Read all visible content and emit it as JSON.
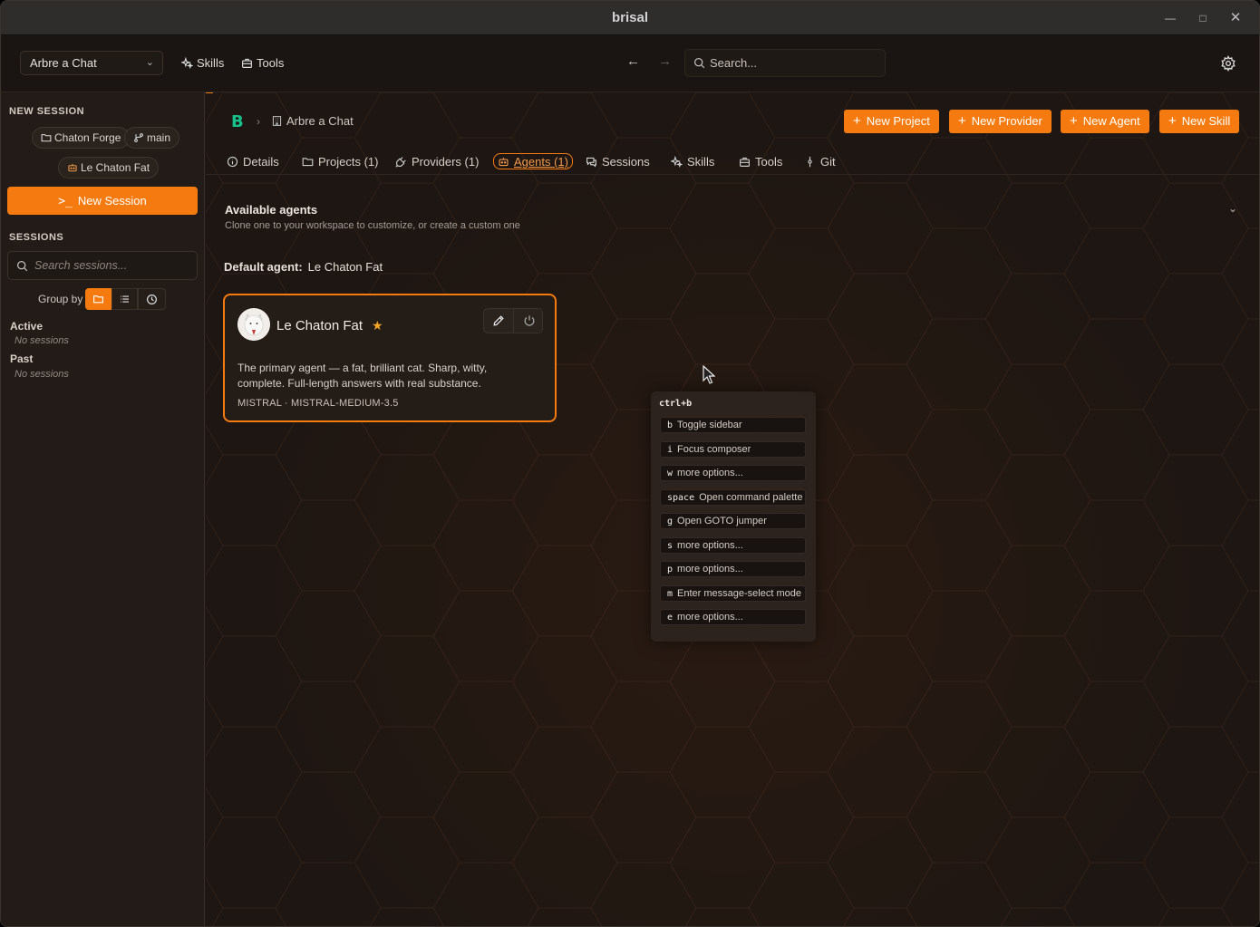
{
  "window": {
    "title": "brisal"
  },
  "header": {
    "project_select": "Arbre a Chat",
    "skills_label": "Skills",
    "tools_label": "Tools",
    "search_placeholder": "Search..."
  },
  "sidebar": {
    "new_session_title": "NEW SESSION",
    "chips": {
      "project": "Chaton Forge",
      "branch": "main",
      "agent": "Le Chaton Fat"
    },
    "new_session_button": "New Session",
    "sessions_title": "SESSIONS",
    "search_placeholder": "Search sessions...",
    "group_by_label": "Group by",
    "groups": [
      {
        "title": "Active",
        "empty": "No sessions"
      },
      {
        "title": "Past",
        "empty": "No sessions"
      }
    ]
  },
  "main": {
    "brand": "B",
    "breadcrumb": "Arbre a Chat",
    "buttons": {
      "new_project": "New Project",
      "new_provider": "New Provider",
      "new_agent": "New Agent",
      "new_skill": "New Skill"
    },
    "tabs": [
      {
        "label": "Details"
      },
      {
        "label": "Projects (1)"
      },
      {
        "label": "Providers (1)"
      },
      {
        "label": "Agents (1)"
      },
      {
        "label": "Sessions"
      },
      {
        "label": "Skills"
      },
      {
        "label": "Tools"
      },
      {
        "label": "Git"
      }
    ],
    "active_tab": "Agents (1)",
    "available": {
      "title": "Available agents",
      "subtitle": "Clone one to your workspace to customize, or create a custom one"
    },
    "default_agent": {
      "label": "Default agent:",
      "value": "Le Chaton Fat"
    },
    "agent_card": {
      "name": "Le Chaton Fat",
      "description": "The primary agent — a fat, brilliant cat. Sharp, witty, complete. Full-length answers with real substance.",
      "model": "MISTRAL · MISTRAL-MEDIUM-3.5"
    }
  },
  "shortcuts": {
    "title": "ctrl+b",
    "items": [
      {
        "key": "b",
        "label": "Toggle sidebar"
      },
      {
        "key": "i",
        "label": "Focus composer"
      },
      {
        "key": "w",
        "label": "more options..."
      },
      {
        "key": "space",
        "label": "Open command palette"
      },
      {
        "key": "g",
        "label": "Open GOTO jumper"
      },
      {
        "key": "s",
        "label": "more options..."
      },
      {
        "key": "p",
        "label": "more options..."
      },
      {
        "key": "m",
        "label": "Enter message-select mode"
      },
      {
        "key": "e",
        "label": "more options..."
      }
    ]
  },
  "colors": {
    "accent": "#f57b10",
    "brand": "#17c08a",
    "background": "#1d1612"
  }
}
